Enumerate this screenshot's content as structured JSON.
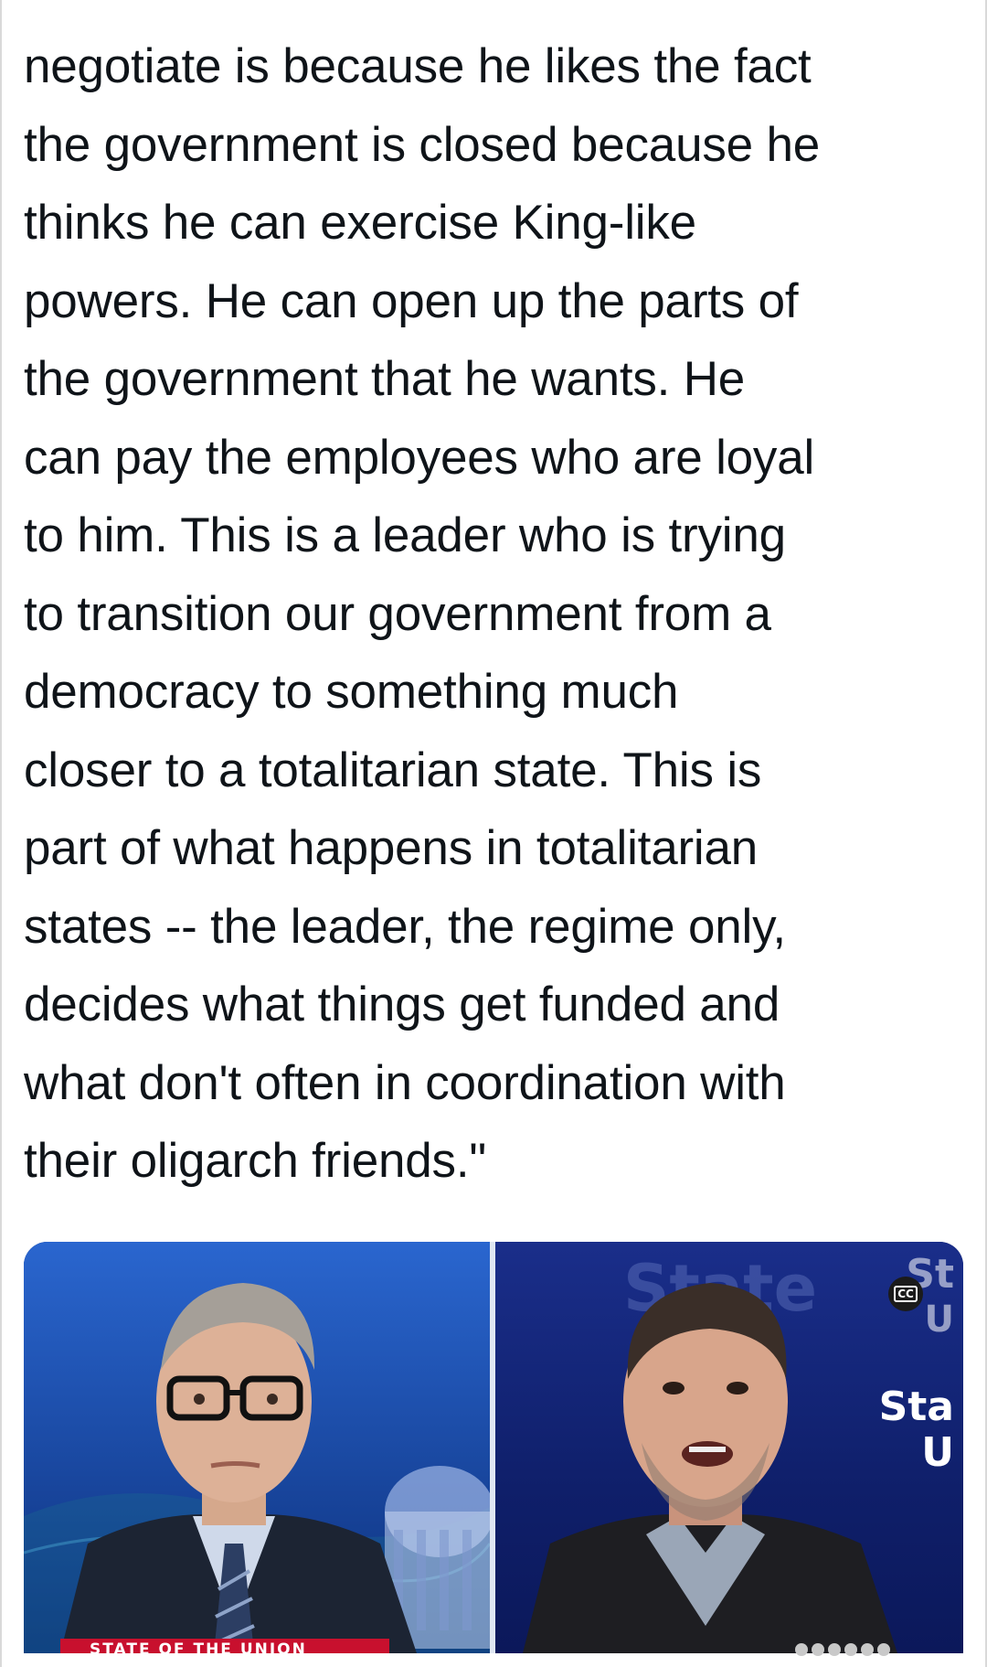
{
  "post": {
    "lines": [
      "negotiate is because he likes the fact",
      "the government is closed because he",
      "thinks he can exercise King-like",
      "powers. He can open up the parts of",
      "the government that he wants. He",
      "can pay the employees who are loyal",
      "to him. This is a leader who is trying",
      "to transition our government from a",
      "democracy to something much",
      "closer to a totalitarian state. This is",
      "part of what happens in totalitarian",
      "states -- the leader, the regime only,",
      "decides what things get funded and",
      "what don't often in coordination with",
      "their oligarch friends.\""
    ]
  },
  "media": {
    "cc_label": "CC",
    "lower_third": "STATE OF THE UNION",
    "bg_brand_text": "State",
    "side_brand_top": "St",
    "side_brand_top_2": "U",
    "side_brand_mid": "Sta",
    "side_brand_mid_2": "U"
  },
  "colors": {
    "text": "#0f1419",
    "studio_blue": "#123c96",
    "cnn_red": "#c8102e"
  }
}
